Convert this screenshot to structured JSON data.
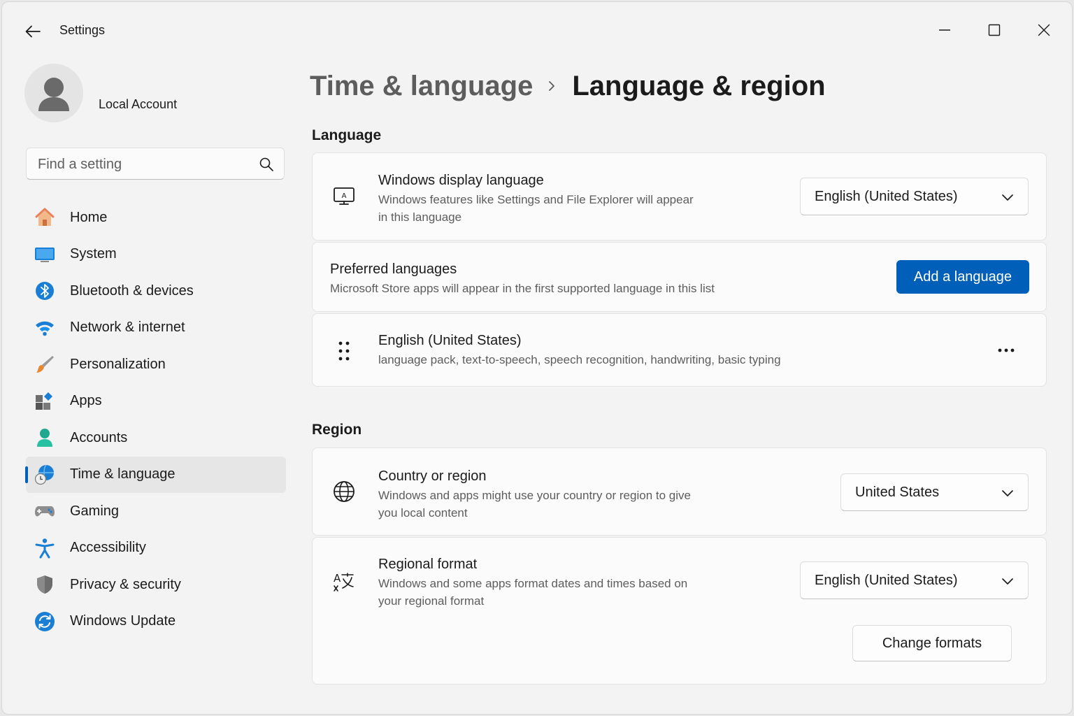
{
  "window": {
    "title": "Settings"
  },
  "account": {
    "name": "Local Account"
  },
  "search": {
    "placeholder": "Find a setting"
  },
  "sidebar": {
    "items": [
      {
        "label": "Home",
        "icon": "home-icon"
      },
      {
        "label": "System",
        "icon": "system-icon"
      },
      {
        "label": "Bluetooth & devices",
        "icon": "bluetooth-icon"
      },
      {
        "label": "Network & internet",
        "icon": "wifi-icon"
      },
      {
        "label": "Personalization",
        "icon": "brush-icon"
      },
      {
        "label": "Apps",
        "icon": "apps-icon"
      },
      {
        "label": "Accounts",
        "icon": "accounts-icon"
      },
      {
        "label": "Time & language",
        "icon": "time-language-icon",
        "selected": true
      },
      {
        "label": "Gaming",
        "icon": "gamepad-icon"
      },
      {
        "label": "Accessibility",
        "icon": "accessibility-icon"
      },
      {
        "label": "Privacy & security",
        "icon": "shield-icon"
      },
      {
        "label": "Windows Update",
        "icon": "update-icon"
      }
    ]
  },
  "breadcrumb": {
    "parent": "Time & language",
    "current": "Language & region"
  },
  "language_section": {
    "title": "Language",
    "display_language": {
      "title": "Windows display language",
      "desc_line1": "Windows features like Settings and File Explorer will appear",
      "desc_line2": "in this language",
      "value": "English (United States)"
    },
    "preferred": {
      "title": "Preferred languages",
      "desc": "Microsoft Store apps will appear in the first supported language in this list",
      "button": "Add a language"
    },
    "installed": {
      "title": "English (United States)",
      "desc": "language pack, text-to-speech, speech recognition, handwriting, basic typing"
    }
  },
  "region_section": {
    "title": "Region",
    "country": {
      "title": "Country or region",
      "desc_line1": "Windows and apps might use your country or region to give",
      "desc_line2": "you local content",
      "value": "United States"
    },
    "format": {
      "title": "Regional format",
      "desc_line1": "Windows and some apps format dates and times based on",
      "desc_line2": "your regional format",
      "value": "English (United States)",
      "button": "Change formats"
    }
  },
  "colors": {
    "accent": "#005fb8",
    "background": "#f3f3f3",
    "card": "#fbfbfb"
  }
}
